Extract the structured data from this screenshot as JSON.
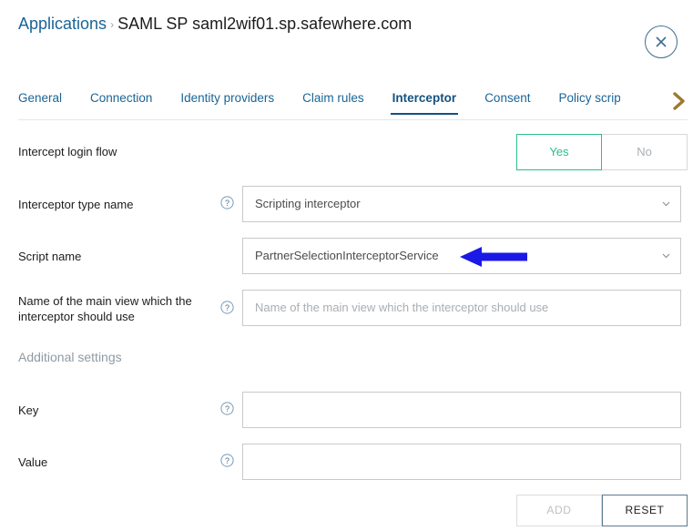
{
  "header": {
    "breadcrumb_root": "Applications",
    "breadcrumb_separator": "›",
    "breadcrumb_current": "SAML SP saml2wif01.sp.safewhere.com",
    "close_label": "close-icon"
  },
  "tabs": [
    {
      "label": "General",
      "active": false
    },
    {
      "label": "Connection",
      "active": false
    },
    {
      "label": "Identity providers",
      "active": false
    },
    {
      "label": "Claim rules",
      "active": false
    },
    {
      "label": "Interceptor",
      "active": true
    },
    {
      "label": "Consent",
      "active": false
    },
    {
      "label": "Policy script",
      "active": false
    }
  ],
  "form": {
    "intercept_login_flow": {
      "label": "Intercept login flow",
      "yes": "Yes",
      "no": "No",
      "selected": "Yes"
    },
    "interceptor_type_name": {
      "label": "Interceptor type name",
      "value": "Scripting interceptor"
    },
    "script_name": {
      "label": "Script name",
      "value": "PartnerSelectionInterceptorService"
    },
    "main_view_name": {
      "label": "Name of the main view which the interceptor should use",
      "value": "",
      "placeholder": "Name of the main view which the interceptor should use"
    },
    "additional_settings_heading": "Additional settings",
    "key": {
      "label": "Key",
      "value": "",
      "placeholder": ""
    },
    "value": {
      "label": "Value",
      "value": "",
      "placeholder": ""
    }
  },
  "buttons": {
    "add": "ADD",
    "reset": "RESET"
  },
  "colors": {
    "link_blue": "#1a6496",
    "active_tab": "#15527f",
    "toggle_on_green": "#2bbd8c",
    "annotation_blue": "#1a19e6",
    "muted_text": "#8f9aa3",
    "border": "#c9c9c9"
  },
  "annotation": {
    "type": "arrow",
    "direction": "left",
    "target": "script_name-select"
  }
}
